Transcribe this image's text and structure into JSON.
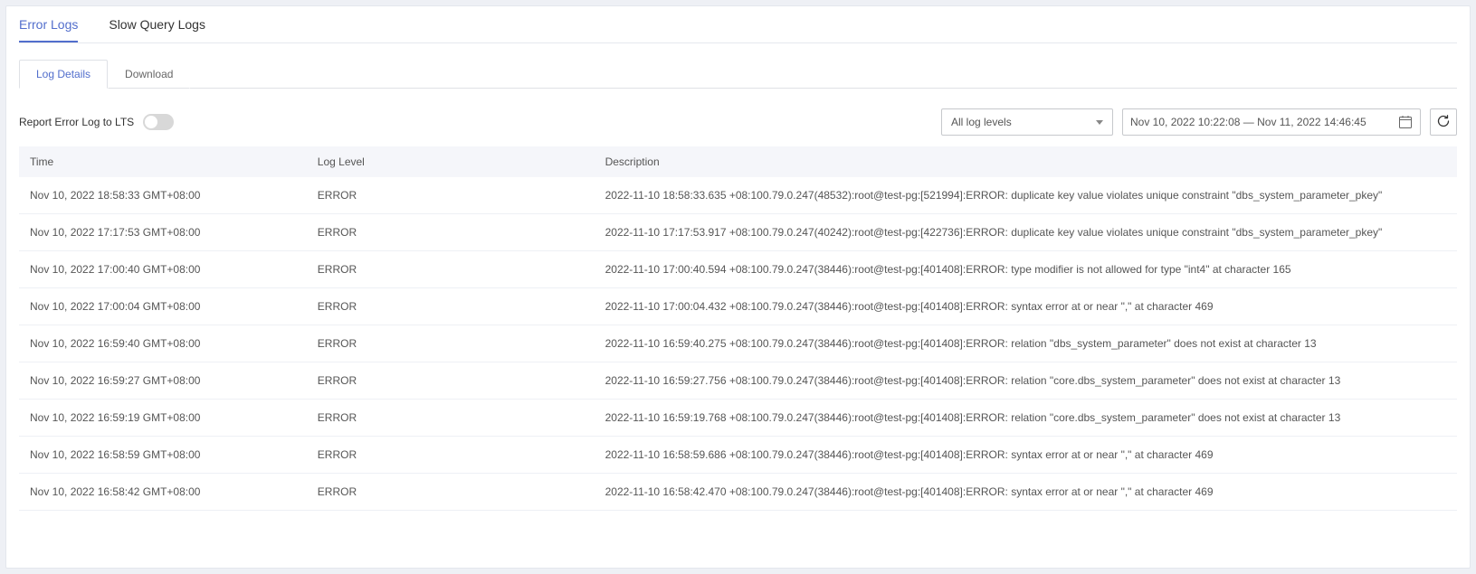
{
  "tabs1": [
    {
      "label": "Error Logs",
      "active": true
    },
    {
      "label": "Slow Query Logs",
      "active": false
    }
  ],
  "tabs2": [
    {
      "label": "Log Details",
      "active": true
    },
    {
      "label": "Download",
      "active": false
    }
  ],
  "report_lts_label": "Report Error Log to LTS",
  "filter": {
    "log_level_selected": "All log levels",
    "date_range": "Nov 10, 2022 10:22:08 — Nov 11, 2022 14:46:45"
  },
  "columns": {
    "time": "Time",
    "level": "Log Level",
    "description": "Description"
  },
  "rows": [
    {
      "time": "Nov 10, 2022 18:58:33 GMT+08:00",
      "level": "ERROR",
      "description": "2022-11-10 18:58:33.635 +08:100.79.0.247(48532):root@test-pg:[521994]:ERROR: duplicate key value violates unique constraint \"dbs_system_parameter_pkey\""
    },
    {
      "time": "Nov 10, 2022 17:17:53 GMT+08:00",
      "level": "ERROR",
      "description": "2022-11-10 17:17:53.917 +08:100.79.0.247(40242):root@test-pg:[422736]:ERROR: duplicate key value violates unique constraint \"dbs_system_parameter_pkey\""
    },
    {
      "time": "Nov 10, 2022 17:00:40 GMT+08:00",
      "level": "ERROR",
      "description": "2022-11-10 17:00:40.594 +08:100.79.0.247(38446):root@test-pg:[401408]:ERROR: type modifier is not allowed for type \"int4\" at character 165"
    },
    {
      "time": "Nov 10, 2022 17:00:04 GMT+08:00",
      "level": "ERROR",
      "description": "2022-11-10 17:00:04.432 +08:100.79.0.247(38446):root@test-pg:[401408]:ERROR: syntax error at or near \",\" at character 469"
    },
    {
      "time": "Nov 10, 2022 16:59:40 GMT+08:00",
      "level": "ERROR",
      "description": "2022-11-10 16:59:40.275 +08:100.79.0.247(38446):root@test-pg:[401408]:ERROR: relation \"dbs_system_parameter\" does not exist at character 13"
    },
    {
      "time": "Nov 10, 2022 16:59:27 GMT+08:00",
      "level": "ERROR",
      "description": "2022-11-10 16:59:27.756 +08:100.79.0.247(38446):root@test-pg:[401408]:ERROR: relation \"core.dbs_system_parameter\" does not exist at character 13"
    },
    {
      "time": "Nov 10, 2022 16:59:19 GMT+08:00",
      "level": "ERROR",
      "description": "2022-11-10 16:59:19.768 +08:100.79.0.247(38446):root@test-pg:[401408]:ERROR: relation \"core.dbs_system_parameter\" does not exist at character 13"
    },
    {
      "time": "Nov 10, 2022 16:58:59 GMT+08:00",
      "level": "ERROR",
      "description": "2022-11-10 16:58:59.686 +08:100.79.0.247(38446):root@test-pg:[401408]:ERROR: syntax error at or near \",\" at character 469"
    },
    {
      "time": "Nov 10, 2022 16:58:42 GMT+08:00",
      "level": "ERROR",
      "description": "2022-11-10 16:58:42.470 +08:100.79.0.247(38446):root@test-pg:[401408]:ERROR: syntax error at or near \",\" at character 469"
    }
  ]
}
